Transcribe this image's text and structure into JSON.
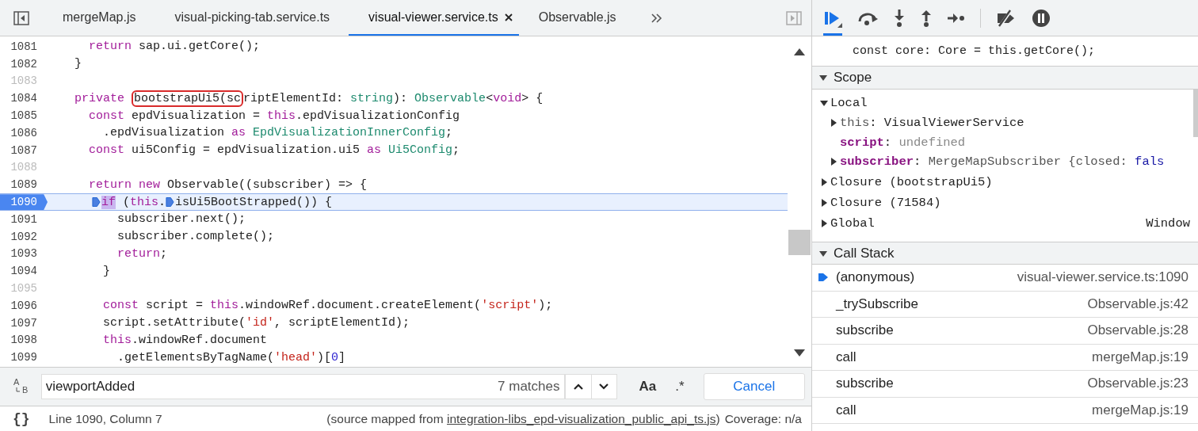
{
  "editor": {
    "tabs": [
      {
        "label": "mergeMap.js",
        "selected": false
      },
      {
        "label": "visual-picking-tab.service.ts",
        "selected": false
      },
      {
        "label": "visual-viewer.service.ts",
        "selected": true
      },
      {
        "label": "Observable.js",
        "selected": false
      }
    ],
    "lines": [
      {
        "number": "1081",
        "mapped": true,
        "current": false,
        "tokens": [
          {
            "kind": "kw",
            "text": "    return"
          },
          {
            "kind": "plain",
            "text": " sap.ui.getCore();"
          }
        ]
      },
      {
        "number": "1082",
        "mapped": true,
        "current": false,
        "tokens": [
          {
            "kind": "plain",
            "text": "  }"
          }
        ]
      },
      {
        "number": "1083",
        "mapped": false,
        "current": false
      },
      {
        "number": "1084",
        "mapped": true,
        "current": false,
        "tokens": [
          {
            "kind": "kw",
            "text": "  private "
          },
          {
            "kind": "boxed",
            "text": "bootstrapUi5(sc"
          },
          {
            "kind": "plain",
            "text": "riptElementId: "
          },
          {
            "kind": "type",
            "text": "string"
          },
          {
            "kind": "plain",
            "text": "): "
          },
          {
            "kind": "type",
            "text": "Observable"
          },
          {
            "kind": "plain",
            "text": "<"
          },
          {
            "kind": "kw",
            "text": "void"
          },
          {
            "kind": "plain",
            "text": "> {"
          }
        ]
      },
      {
        "number": "1085",
        "mapped": true,
        "current": false,
        "tokens": [
          {
            "kind": "kw",
            "text": "    const"
          },
          {
            "kind": "plain",
            "text": " epdVisualization = "
          },
          {
            "kind": "kw",
            "text": "this"
          },
          {
            "kind": "plain",
            "text": ".epdVisualizationConfig"
          }
        ]
      },
      {
        "number": "1086",
        "mapped": true,
        "current": false,
        "tokens": [
          {
            "kind": "plain",
            "text": "      .epdVisualization "
          },
          {
            "kind": "kw",
            "text": "as "
          },
          {
            "kind": "type",
            "text": "EpdVisualizationInnerConfig"
          },
          {
            "kind": "plain",
            "text": ";"
          }
        ]
      },
      {
        "number": "1087",
        "mapped": true,
        "current": false,
        "tokens": [
          {
            "kind": "kw",
            "text": "    const"
          },
          {
            "kind": "plain",
            "text": " ui5Config = epdVisualization.ui5 "
          },
          {
            "kind": "kw",
            "text": "as "
          },
          {
            "kind": "type",
            "text": "Ui5Config"
          },
          {
            "kind": "plain",
            "text": ";"
          }
        ]
      },
      {
        "number": "1088",
        "mapped": false,
        "current": false
      },
      {
        "number": "1089",
        "mapped": true,
        "current": false,
        "tokens": [
          {
            "kind": "kw",
            "text": "    return new"
          },
          {
            "kind": "plain",
            "text": " Observable((subscriber) => {"
          }
        ]
      },
      {
        "number": "1090",
        "mapped": true,
        "current": true,
        "tokens": [
          {
            "kind": "bp"
          },
          {
            "kind": "kw-hit",
            "text": "if"
          },
          {
            "kind": "plain",
            "text": " ("
          },
          {
            "kind": "kw",
            "text": "this"
          },
          {
            "kind": "plain",
            "text": "."
          },
          {
            "kind": "bp"
          },
          {
            "kind": "plain",
            "text": "isUi5BootStrapped()) {"
          }
        ]
      },
      {
        "number": "1091",
        "mapped": true,
        "current": false,
        "tokens": [
          {
            "kind": "plain",
            "text": "        subscriber.next();"
          }
        ]
      },
      {
        "number": "1092",
        "mapped": true,
        "current": false,
        "tokens": [
          {
            "kind": "plain",
            "text": "        subscriber.complete();"
          }
        ]
      },
      {
        "number": "1093",
        "mapped": true,
        "current": false,
        "tokens": [
          {
            "kind": "kw",
            "text": "        return"
          },
          {
            "kind": "plain",
            "text": ";"
          }
        ]
      },
      {
        "number": "1094",
        "mapped": true,
        "current": false,
        "tokens": [
          {
            "kind": "plain",
            "text": "      }"
          }
        ]
      },
      {
        "number": "1095",
        "mapped": false,
        "current": false
      },
      {
        "number": "1096",
        "mapped": true,
        "current": false,
        "tokens": [
          {
            "kind": "kw",
            "text": "      const"
          },
          {
            "kind": "plain",
            "text": " script = "
          },
          {
            "kind": "kw",
            "text": "this"
          },
          {
            "kind": "plain",
            "text": ".windowRef.document.createElement("
          },
          {
            "kind": "str",
            "text": "'script'"
          },
          {
            "kind": "plain",
            "text": ");"
          }
        ]
      },
      {
        "number": "1097",
        "mapped": true,
        "current": false,
        "tokens": [
          {
            "kind": "plain",
            "text": "      script.setAttribute("
          },
          {
            "kind": "str",
            "text": "'id'"
          },
          {
            "kind": "plain",
            "text": ", scriptElementId);"
          }
        ]
      },
      {
        "number": "1098",
        "mapped": true,
        "current": false,
        "tokens": [
          {
            "kind": "kw",
            "text": "      this"
          },
          {
            "kind": "plain",
            "text": ".windowRef.document"
          }
        ]
      },
      {
        "number": "1099",
        "mapped": true,
        "current": false,
        "tokens": [
          {
            "kind": "plain",
            "text": "        .getElementsByTagName("
          },
          {
            "kind": "str",
            "text": "'head'"
          },
          {
            "kind": "plain",
            "text": ")["
          },
          {
            "kind": "num",
            "text": "0"
          },
          {
            "kind": "plain",
            "text": "]"
          }
        ]
      }
    ]
  },
  "search": {
    "replace_toggle": {
      "upper": "A",
      "lower": "B"
    },
    "value": "viewportAdded",
    "matches": "7 matches",
    "case_button": "Aa",
    "regex_button": ".*",
    "cancel": "Cancel"
  },
  "status_bar": {
    "format_button": "{}",
    "position": "Line 1090, Column 7",
    "source_prefix": "(source mapped from ",
    "source_link": "integration-libs_epd-visualization_public_api_ts.js",
    "source_suffix": ")",
    "coverage": "Coverage: n/a"
  },
  "debugger": {
    "toolbar": [
      {
        "kind": "resume",
        "active": true
      },
      {
        "kind": "step-over",
        "active": false
      },
      {
        "kind": "step-into",
        "active": false
      },
      {
        "kind": "step-out",
        "active": false
      },
      {
        "kind": "step",
        "active": false
      },
      {
        "kind": "deactivate",
        "active": false
      },
      {
        "kind": "pause-exceptions",
        "active": false
      }
    ],
    "preview_line": "const core: Core = this.getCore();",
    "scope": {
      "title": "Scope",
      "expanded": true,
      "groups": [
        {
          "name": "Local",
          "expanded": true,
          "children": [
            {
              "name": "this",
              "separator": ": ",
              "own": false,
              "expandable": true,
              "expanded": false,
              "value": [
                {
                  "kind": "obj",
                  "text": "VisualViewerService"
                }
              ]
            },
            {
              "name": "script",
              "separator": ": ",
              "own": true,
              "expandable": false,
              "value": [
                {
                  "kind": "undef",
                  "text": "undefined"
                }
              ]
            },
            {
              "name": "subscriber",
              "separator": ": ",
              "own": true,
              "expandable": true,
              "expanded": false,
              "value": [
                {
                  "kind": "preview",
                  "text": "MergeMapSubscriber {closed: "
                },
                {
                  "kind": "bool",
                  "text": "fals"
                }
              ]
            }
          ]
        },
        {
          "name": "Closure (bootstrapUi5)",
          "expanded": false
        },
        {
          "name": "Closure (71584)",
          "expanded": false
        },
        {
          "name": "Global",
          "value": "Window",
          "expanded": false
        }
      ]
    },
    "call_stack": {
      "title": "Call Stack",
      "expanded": true,
      "frames": [
        {
          "function": "(anonymous)",
          "location": "visual-viewer.service.ts:1090",
          "selected": true
        },
        {
          "function": "_trySubscribe",
          "location": "Observable.js:42",
          "selected": false
        },
        {
          "function": "subscribe",
          "location": "Observable.js:28",
          "selected": false
        },
        {
          "function": "call",
          "location": "mergeMap.js:19",
          "selected": false
        },
        {
          "function": "subscribe",
          "location": "Observable.js:23",
          "selected": false
        },
        {
          "function": "call",
          "location": "mergeMap.js:19",
          "selected": false
        }
      ]
    }
  }
}
